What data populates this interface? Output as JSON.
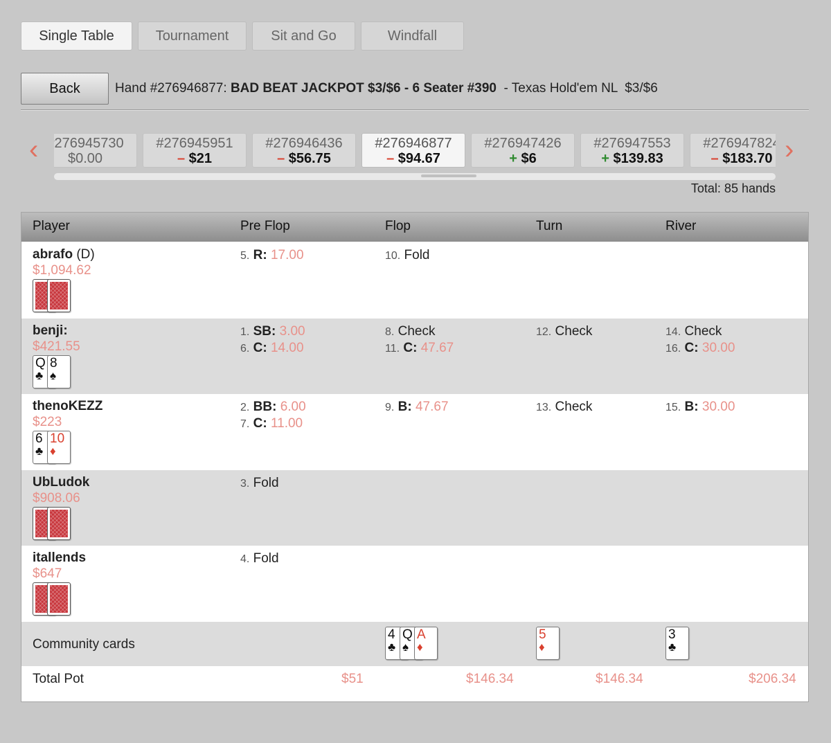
{
  "tabs": [
    {
      "label": "Single Table",
      "active": true
    },
    {
      "label": "Tournament",
      "active": false
    },
    {
      "label": "Sit and Go",
      "active": false
    },
    {
      "label": "Windfall",
      "active": false
    }
  ],
  "header": {
    "back_label": "Back",
    "hand_prefix": "Hand #276946877: ",
    "table_name": "BAD BEAT JACKPOT $3/$6 - 6 Seater #390",
    "game_info": "  - Texas Hold'em NL  $3/$6"
  },
  "hand_strip": {
    "prev_icon": "chevron-left-icon",
    "next_icon": "chevron-right-icon",
    "hands": [
      {
        "num": "#276945730",
        "sign": "",
        "amount": "$0.00",
        "active": false
      },
      {
        "num": "#276945951",
        "sign": "–",
        "amount": "$21",
        "active": false
      },
      {
        "num": "#276946436",
        "sign": "–",
        "amount": "$56.75",
        "active": false
      },
      {
        "num": "#276946877",
        "sign": "–",
        "amount": "$94.67",
        "active": true
      },
      {
        "num": "#276947426",
        "sign": "+",
        "amount": "$6",
        "active": false
      },
      {
        "num": "#276947553",
        "sign": "+",
        "amount": "$139.83",
        "active": false
      },
      {
        "num": "#276947824",
        "sign": "–",
        "amount": "$183.70",
        "active": false
      }
    ],
    "total": "Total: 85 hands"
  },
  "columns": [
    "Player",
    "Pre Flop",
    "Flop",
    "Turn",
    "River"
  ],
  "players": [
    {
      "name": "abrafo",
      "dealer": " (D)",
      "stack": "$1,094.62",
      "cards": [
        {
          "back": true
        },
        {
          "back": true
        }
      ],
      "preflop": [
        {
          "n": "5.",
          "act": "R:",
          "amt": "17.00"
        }
      ],
      "flop": [
        {
          "n": "10.",
          "plain": "Fold"
        }
      ],
      "turn": [],
      "river": []
    },
    {
      "name": "benji:",
      "dealer": "",
      "stack": "$421.55",
      "cards": [
        {
          "rank": "Q",
          "suit": "♣",
          "color": "black"
        },
        {
          "rank": "8",
          "suit": "♠",
          "color": "black"
        }
      ],
      "preflop": [
        {
          "n": "1.",
          "act": "SB:",
          "amt": "3.00"
        },
        {
          "n": "6.",
          "act": "C:",
          "amt": "14.00"
        }
      ],
      "flop": [
        {
          "n": "8.",
          "plain": "Check"
        },
        {
          "n": "11.",
          "act": "C:",
          "amt": "47.67"
        }
      ],
      "turn": [
        {
          "n": "12.",
          "plain": "Check"
        }
      ],
      "river": [
        {
          "n": "14.",
          "plain": "Check"
        },
        {
          "n": "16.",
          "act": "C:",
          "amt": "30.00"
        }
      ]
    },
    {
      "name": "thenoKEZZ",
      "dealer": "",
      "stack": "$223",
      "cards": [
        {
          "rank": "6",
          "suit": "♣",
          "color": "black"
        },
        {
          "rank": "10",
          "suit": "♦",
          "color": "red"
        }
      ],
      "preflop": [
        {
          "n": "2.",
          "act": "BB:",
          "amt": "6.00"
        },
        {
          "n": "7.",
          "act": "C:",
          "amt": "11.00"
        }
      ],
      "flop": [
        {
          "n": "9.",
          "act": "B:",
          "amt": "47.67"
        }
      ],
      "turn": [
        {
          "n": "13.",
          "plain": "Check"
        }
      ],
      "river": [
        {
          "n": "15.",
          "act": "B:",
          "amt": "30.00"
        }
      ]
    },
    {
      "name": "UbLudok",
      "dealer": "",
      "stack": "$908.06",
      "cards": [
        {
          "back": true
        },
        {
          "back": true
        }
      ],
      "preflop": [
        {
          "n": "3.",
          "plain": "Fold"
        }
      ],
      "flop": [],
      "turn": [],
      "river": []
    },
    {
      "name": "itallends",
      "dealer": "",
      "stack": "$647",
      "cards": [
        {
          "back": true
        },
        {
          "back": true
        }
      ],
      "preflop": [
        {
          "n": "4.",
          "plain": "Fold"
        }
      ],
      "flop": [],
      "turn": [],
      "river": []
    }
  ],
  "community": {
    "label": "Community cards",
    "flop": [
      {
        "rank": "4",
        "suit": "♣",
        "color": "black"
      },
      {
        "rank": "Q",
        "suit": "♠",
        "color": "black"
      },
      {
        "rank": "A",
        "suit": "♦",
        "color": "red"
      }
    ],
    "turn": [
      {
        "rank": "5",
        "suit": "♦",
        "color": "red"
      }
    ],
    "river": [
      {
        "rank": "3",
        "suit": "♣",
        "color": "black"
      }
    ]
  },
  "total_pot": {
    "label": "Total Pot",
    "preflop": "$51",
    "flop": "$146.34",
    "turn": "$146.34",
    "river": "$206.34"
  },
  "colors": {
    "negative": "#d9412f",
    "positive": "#2f8a2f",
    "amount": "#e8918a",
    "prev_arrow": "#e07060"
  }
}
